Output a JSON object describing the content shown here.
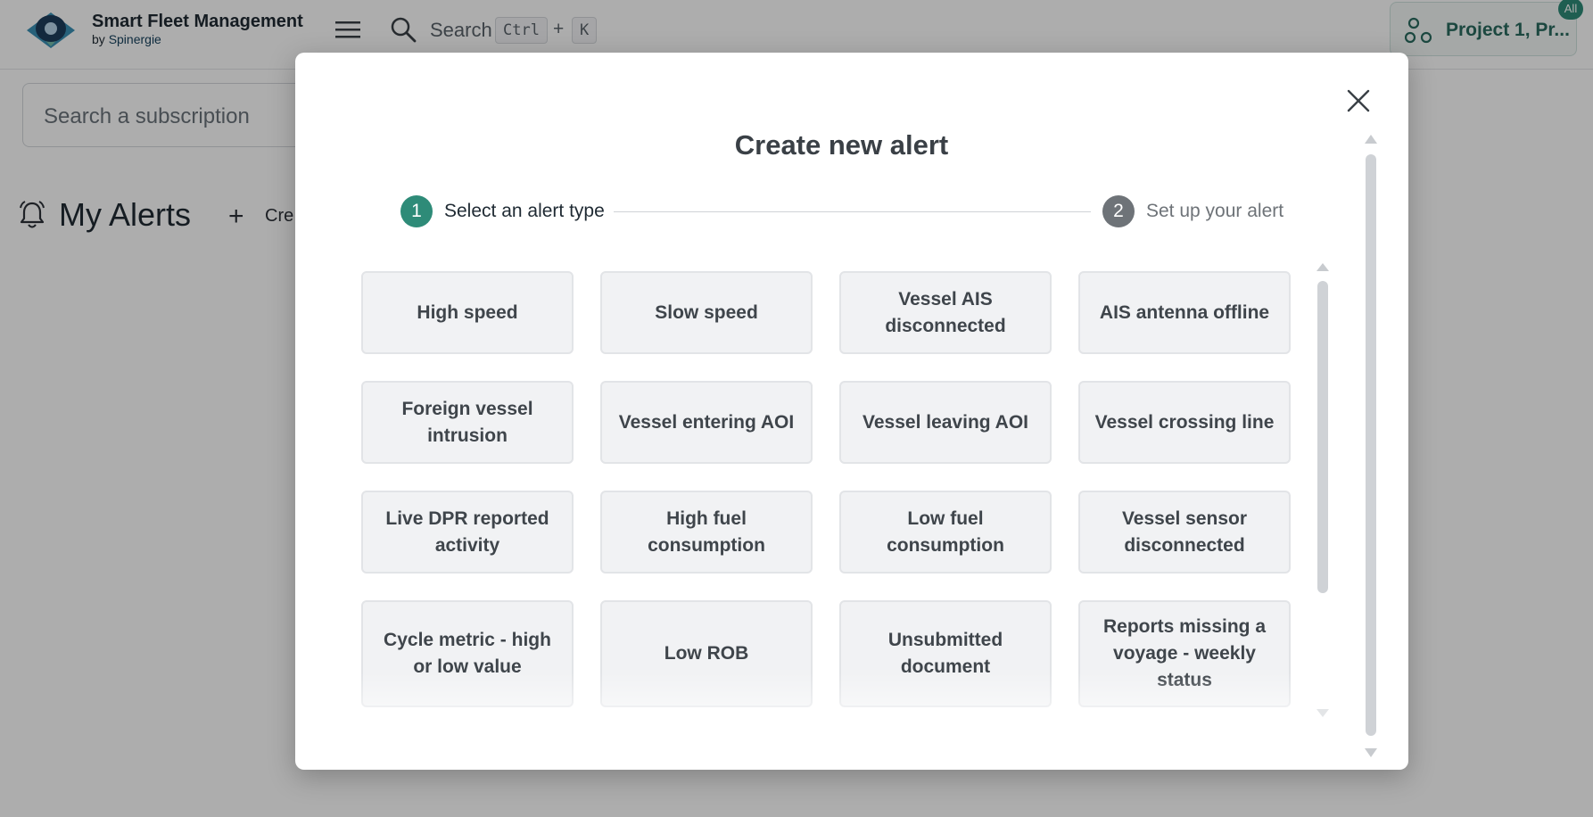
{
  "app": {
    "title": "Smart Fleet Management",
    "subtitle_prefix": "by",
    "subtitle_brand": "Spinergie"
  },
  "topbar": {
    "search_label": "Search",
    "shortcut_ctrl": "Ctrl",
    "shortcut_plus": "+",
    "shortcut_key": "K",
    "project_label": "Project 1, Pr...",
    "project_badge": "All"
  },
  "page": {
    "subscription_search_placeholder": "Search a subscription",
    "alerts_title": "My Alerts",
    "create_plus": "+",
    "create_label": "Cre"
  },
  "modal": {
    "title": "Create new alert",
    "steps": [
      {
        "number": "1",
        "label": "Select an alert type",
        "state": "active"
      },
      {
        "number": "2",
        "label": "Set up your alert",
        "state": "inactive"
      }
    ],
    "alert_types": [
      "High speed",
      "Slow speed",
      "Vessel AIS disconnected",
      "AIS antenna offline",
      "Foreign vessel intrusion",
      "Vessel entering AOI",
      "Vessel leaving AOI",
      "Vessel crossing line",
      "Live DPR reported activity",
      "High fuel consumption",
      "Low fuel consumption",
      "Vessel sensor disconnected",
      "Cycle metric - high or low value",
      "Low ROB",
      "Unsubmitted document",
      "Reports missing a voyage - weekly status"
    ]
  },
  "colors": {
    "accent": "#2e8b78",
    "step_inactive": "#6e7378",
    "card_bg": "#f1f2f4",
    "card_border": "#e2e4e7",
    "overlay": "rgba(0,0,0,0.32)"
  },
  "icons": {
    "logo": "eye-logo-icon",
    "menu": "hamburger-icon",
    "search": "search-icon",
    "project": "project-nodes-icon",
    "alerts": "bell-icon",
    "close": "close-icon"
  }
}
